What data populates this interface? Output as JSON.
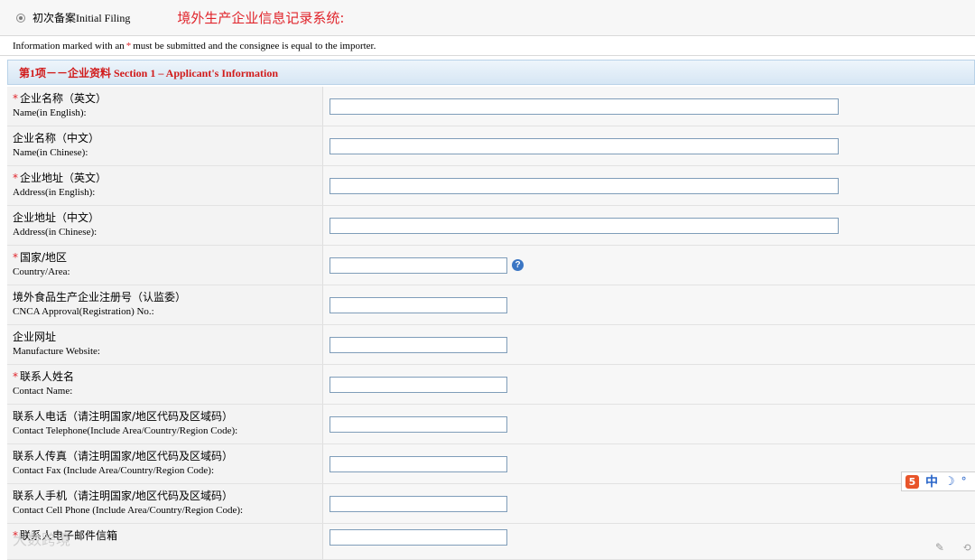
{
  "header": {
    "radio_label": "初次备案Initial Filing",
    "system_title": "境外生产企业信息记录系统:"
  },
  "notice": {
    "before": "Information marked with an",
    "star": "*",
    "after": "must be submitted and the consignee is equal to the importer."
  },
  "section": {
    "title": "第1项－－企业资料  Section 1 – Applicant's Information"
  },
  "fields": [
    {
      "cn": "企业名称（英文）",
      "en": "Name(in English):",
      "required": true,
      "value": ""
    },
    {
      "cn": "企业名称（中文）",
      "en": "Name(in Chinese):",
      "required": false,
      "value": ""
    },
    {
      "cn": "企业地址（英文）",
      "en": "Address(in English):",
      "required": true,
      "value": ""
    },
    {
      "cn": "企业地址（中文）",
      "en": "Address(in Chinese):",
      "required": false,
      "value": ""
    },
    {
      "cn": "国家/地区",
      "en": "Country/Area:",
      "required": true,
      "value": ""
    },
    {
      "cn": "境外食品生产企业注册号（认监委）",
      "en": "CNCA Approval(Registration) No.:",
      "required": false,
      "value": ""
    },
    {
      "cn": "企业网址",
      "en": "Manufacture Website:",
      "required": false,
      "value": ""
    },
    {
      "cn": "联系人姓名",
      "en": "Contact Name:",
      "required": true,
      "value": ""
    },
    {
      "cn": "联系人电话（请注明国家/地区代码及区域码）",
      "en": "Contact Telephone(Include Area/Country/Region Code):",
      "required": false,
      "value": ""
    },
    {
      "cn": "联系人传真（请注明国家/地区代码及区域码）",
      "en": "Contact Fax (Include Area/Country/Region Code):",
      "required": false,
      "value": ""
    },
    {
      "cn": "联系人手机（请注明国家/地区代码及区域码）",
      "en": "Contact Cell Phone (Include Area/Country/Region Code):",
      "required": false,
      "value": ""
    },
    {
      "cn": "联系人电子邮件信箱",
      "en": "",
      "required": true,
      "value": ""
    }
  ],
  "required_mark": "*",
  "help_icon_glyph": "?",
  "ime": {
    "logo": "5",
    "lang": "中",
    "moon": "☽",
    "dot": "°"
  },
  "watermark": "大数跨境",
  "colors": {
    "accent_red": "#e0242b",
    "section_blue": "#d6e6f4",
    "input_border": "#7f9db9"
  }
}
